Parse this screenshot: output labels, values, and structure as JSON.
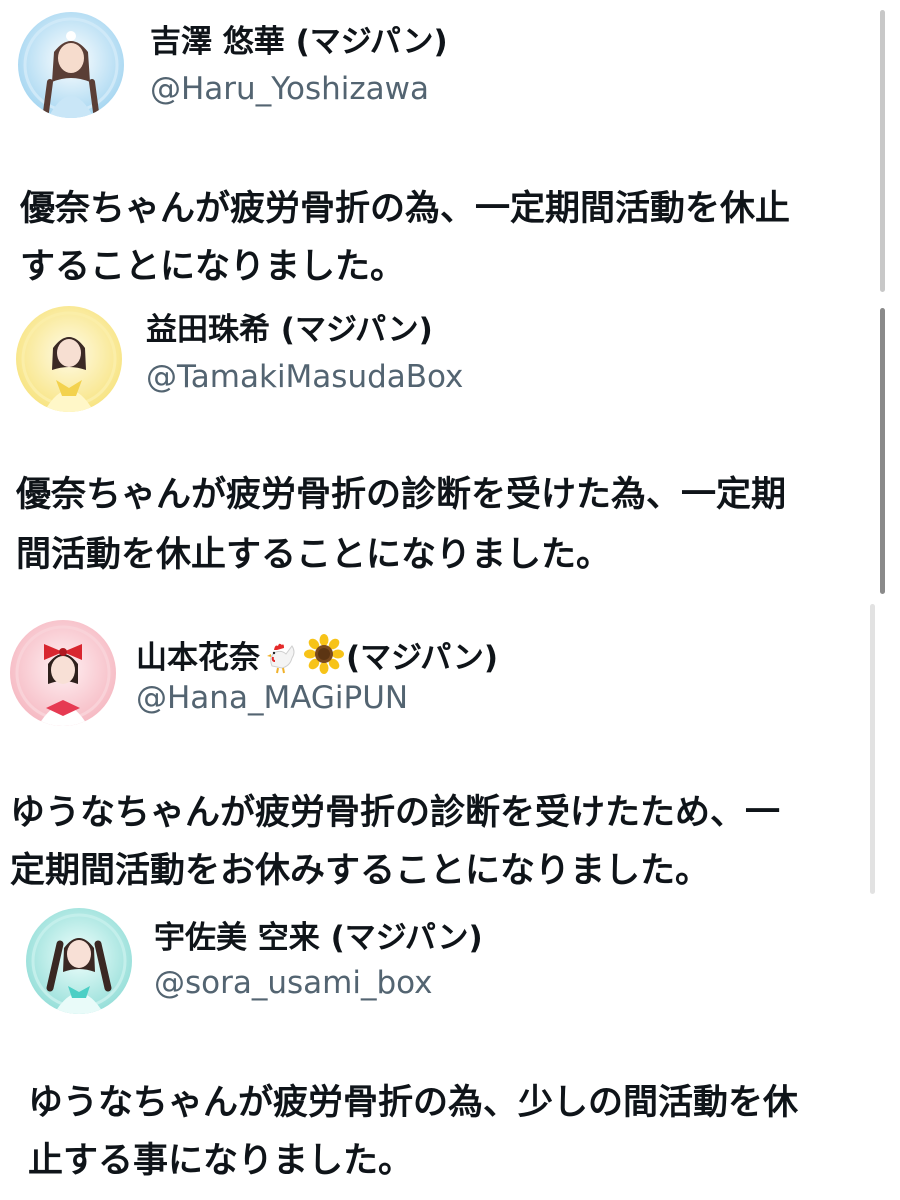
{
  "posts": [
    {
      "display_name": "吉澤 悠華 (マジパン)",
      "handle": "@Haru_Yoshizawa",
      "text_lines": [
        "優奈ちゃんが疲労骨折の為、一定期間活動を休止",
        "することになりました。"
      ],
      "avatar_theme": "#9fd3f0"
    },
    {
      "display_name": "益田珠希 (マジパン)",
      "handle": "@TamakiMasudaBox",
      "text_lines": [
        "優奈ちゃんが疲労骨折の診断を受けた為、一定期",
        "間活動を休止することになりました。"
      ],
      "avatar_theme": "#f7e27a"
    },
    {
      "display_name_prefix": "山本花奈",
      "display_name_suffix": "(マジパン)",
      "name_icons": [
        "rooster-emoji",
        "sunflower-emoji"
      ],
      "handle": "@Hana_MAGiPUN",
      "text_lines": [
        "ゆうなちゃんが疲労骨折の診断を受けたため、一",
        "定期間活動をお休みすることになりました。"
      ],
      "avatar_theme": "#f5b5bf"
    },
    {
      "display_name": "宇佐美 空来 (マジパン)",
      "handle": "@sora_usami_box",
      "text_lines": [
        "ゆうなちゃんが疲労骨折の為、少しの間活動を休",
        "止する事になりました。"
      ],
      "avatar_theme": "#8fdcd6"
    }
  ],
  "colors": {
    "text_primary": "#0f1419",
    "text_secondary": "#536471",
    "scrollbar": "#8a8a8a"
  }
}
